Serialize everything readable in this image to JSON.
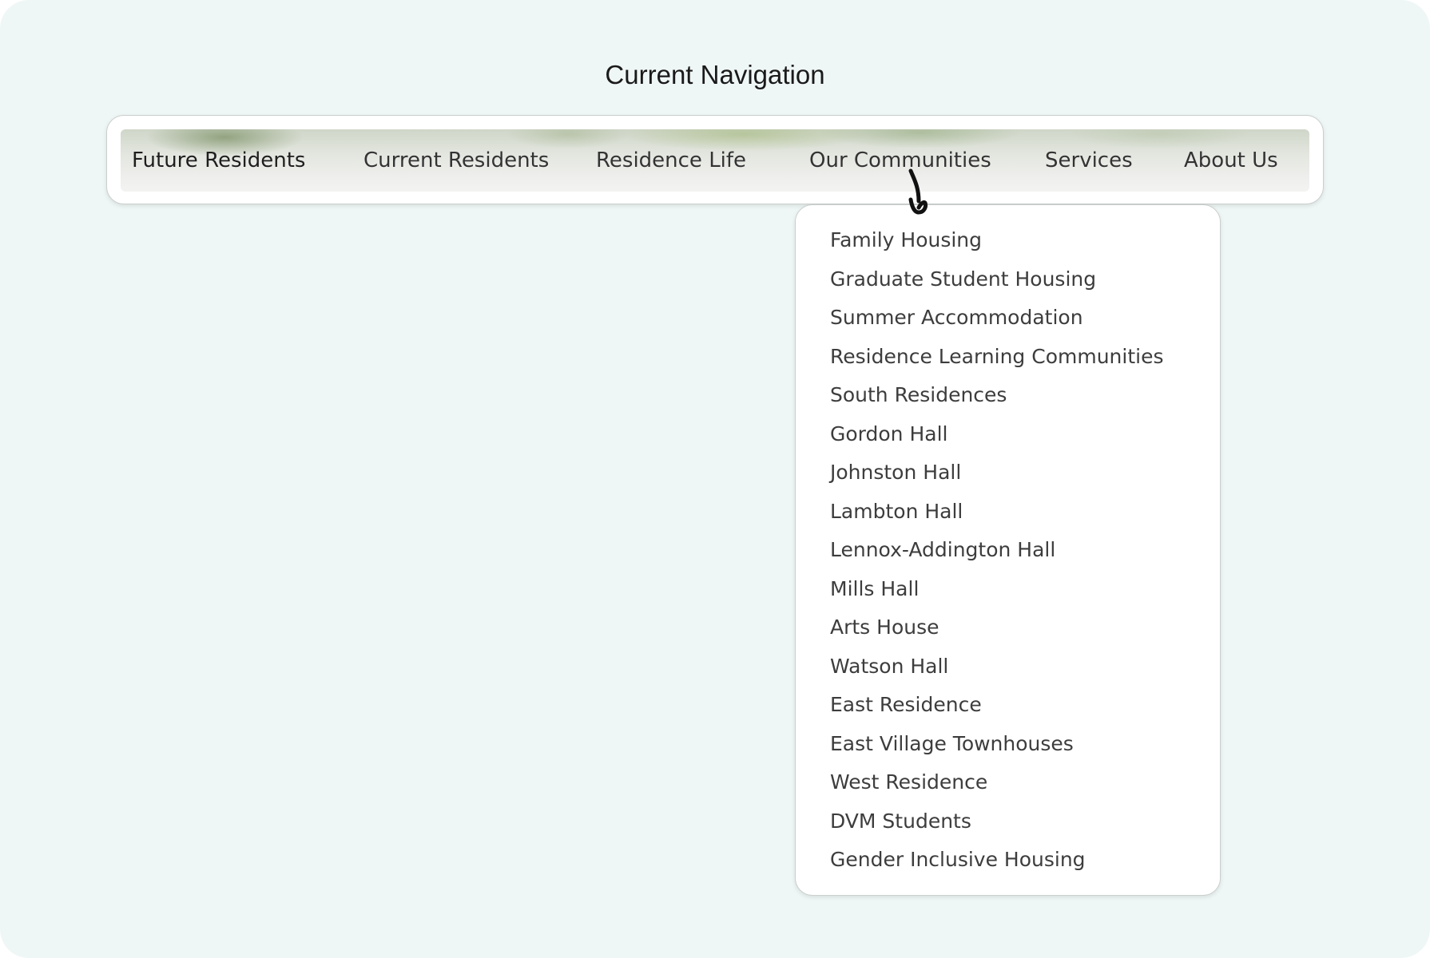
{
  "page": {
    "title": "Current Navigation"
  },
  "nav": {
    "items": [
      {
        "label": "Future Residents"
      },
      {
        "label": "Current Residents"
      },
      {
        "label": "Residence Life"
      },
      {
        "label": "Our Communities"
      },
      {
        "label": "Services"
      },
      {
        "label": "About Us"
      }
    ],
    "active_item": "Our Communities"
  },
  "dropdown": {
    "items": [
      {
        "label": "Family Housing"
      },
      {
        "label": "Graduate Student Housing"
      },
      {
        "label": "Summer Accommodation"
      },
      {
        "label": "Residence Learning Communities"
      },
      {
        "label": "South Residences"
      },
      {
        "label": "Gordon Hall"
      },
      {
        "label": "Johnston Hall"
      },
      {
        "label": "Lambton Hall"
      },
      {
        "label": "Lennox-Addington Hall"
      },
      {
        "label": "Mills Hall"
      },
      {
        "label": "Arts House"
      },
      {
        "label": "Watson Hall"
      },
      {
        "label": "East Residence"
      },
      {
        "label": "East Village Townhouses"
      },
      {
        "label": "West Residence"
      },
      {
        "label": "DVM Students"
      },
      {
        "label": "Gender Inclusive Housing"
      }
    ]
  },
  "icons": {
    "cursor": "hand-drawn-arrow-icon"
  },
  "colors": {
    "background": "#eff7f6",
    "panel": "#ffffff",
    "border": "#c9cfcd",
    "text": "#3d3d3d"
  }
}
